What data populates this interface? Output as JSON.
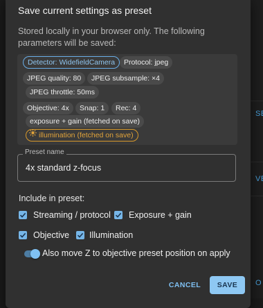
{
  "background": {
    "text1": "SE",
    "text2": "VE C",
    "text3": "O F"
  },
  "dialog": {
    "title": "Save current settings as preset",
    "info": "Stored locally in your browser only. The following parameters will be saved:",
    "chips": {
      "detector": "Detector: WidefieldCamera",
      "protocol": "Protocol: jpeg",
      "jpeg_quality": "JPEG quality: 80",
      "jpeg_subsample": "JPEG subsample: ×4",
      "jpeg_throttle": "JPEG throttle: 50ms",
      "objective": "Objective: 4x",
      "snap": "Snap: 1",
      "rec": "Rec: 4",
      "exposure_gain": "exposure + gain (fetched on save)",
      "illumination": "illumination (fetched on save)"
    },
    "preset_name": {
      "label": "Preset name",
      "value": "4x standard z-focus"
    },
    "include_label": "Include in preset:",
    "checkboxes": {
      "streaming": "Streaming / protocol",
      "exposure": "Exposure + gain",
      "objective": "Objective",
      "illumination": "Illumination"
    },
    "toggle_label": "Also move Z to objective preset position on apply",
    "buttons": {
      "cancel": "CANCEL",
      "save": "SAVE"
    }
  },
  "colors": {
    "accent": "#8ec8f3",
    "chip_blue": "#6aaee8",
    "chip_orange": "#d99a2b"
  },
  "icons": [
    "checkbox-checked-icon",
    "sun-icon"
  ]
}
